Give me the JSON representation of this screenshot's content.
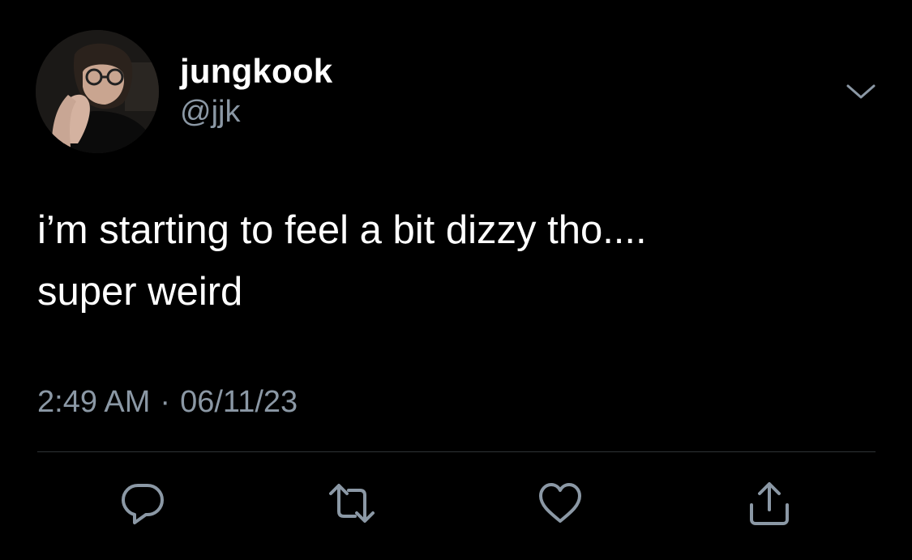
{
  "tweet": {
    "author": {
      "display_name": "jungkook",
      "handle": "@jjk",
      "avatar": "profile-photo"
    },
    "text_lines": [
      "i’m starting to feel a bit dizzy tho....",
      "super weird"
    ],
    "time": "2:49 AM",
    "separator": "·",
    "date": "06/11/23"
  },
  "icons": {
    "more": "chevron-down-icon",
    "reply": "reply-icon",
    "retweet": "retweet-icon",
    "like": "heart-icon",
    "share": "share-icon"
  },
  "colors": {
    "background": "#000000",
    "primary_text": "#ffffff",
    "secondary_text": "#8b98a5",
    "icon": "#8b98a5",
    "divider": "#2f3336"
  }
}
